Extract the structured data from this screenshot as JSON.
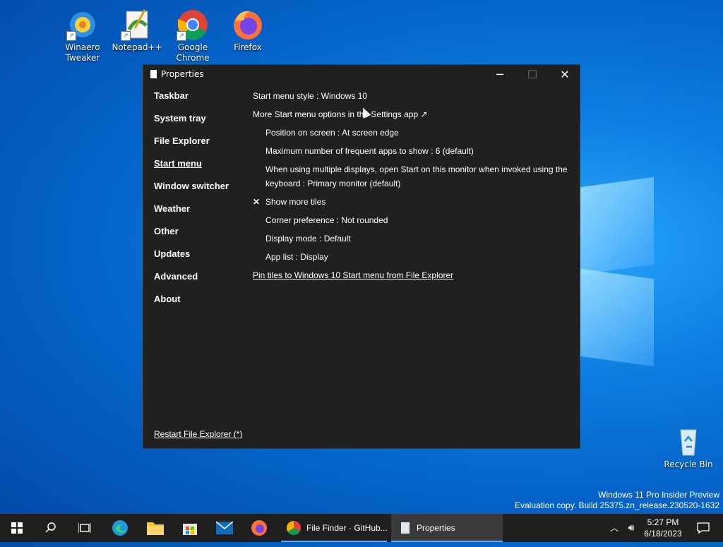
{
  "desktop": {
    "icons": [
      {
        "label_1": "Winaero",
        "label_2": "Tweaker"
      },
      {
        "label_1": "Notepad++",
        "label_2": ""
      },
      {
        "label_1": "Google",
        "label_2": "Chrome"
      },
      {
        "label_1": "Firefox",
        "label_2": ""
      }
    ],
    "recycle_bin": "Recycle Bin",
    "watermark_line1": "Windows 11 Pro Insider Preview",
    "watermark_line2": "Evaluation copy. Build 25375.zn_release.230520-1632"
  },
  "window": {
    "title": "Properties",
    "nav": [
      "Taskbar",
      "System tray",
      "File Explorer",
      "Start menu",
      "Window switcher",
      "Weather",
      "Other",
      "Updates",
      "Advanced",
      "About"
    ],
    "active_nav": "Start menu",
    "settings": {
      "start_menu_style": "Start menu style : Windows 10",
      "more_options": "More Start menu options in the Settings app ↗",
      "position": "Position on screen : At screen edge",
      "max_frequent": "Maximum number of frequent apps to show : 6 (default)",
      "multi_display": "When using multiple displays, open Start on this monitor when invoked using the keyboard : Primary monitor (default)",
      "show_more_tiles_check": "✕",
      "show_more_tiles": "Show more tiles",
      "corner_pref": "Corner preference : Not rounded",
      "display_mode": "Display mode : Default",
      "app_list": "App list : Display",
      "pin_tiles": "Pin tiles to Windows 10 Start menu from File Explorer"
    },
    "restart": "Restart File Explorer (*)"
  },
  "taskbar": {
    "apps": [
      {
        "label": "File Finder · GitHub..."
      },
      {
        "label": "Properties"
      }
    ],
    "time": "5:27 PM",
    "date": "6/18/2023"
  },
  "colors": {
    "window_bg": "#202020",
    "taskbar_bg": "#1f1f1f",
    "accent": "#7aa7d9"
  }
}
